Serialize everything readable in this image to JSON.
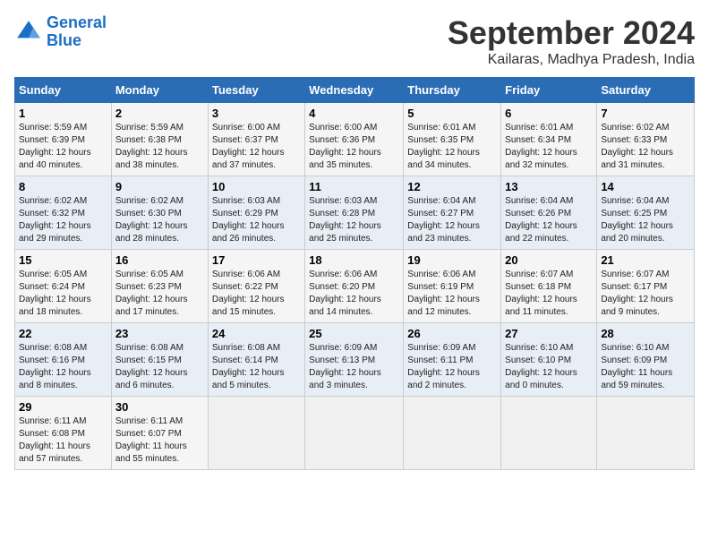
{
  "logo": {
    "line1": "General",
    "line2": "Blue"
  },
  "title": "September 2024",
  "location": "Kailaras, Madhya Pradesh, India",
  "days_of_week": [
    "Sunday",
    "Monday",
    "Tuesday",
    "Wednesday",
    "Thursday",
    "Friday",
    "Saturday"
  ],
  "weeks": [
    [
      {
        "day": "1",
        "info": "Sunrise: 5:59 AM\nSunset: 6:39 PM\nDaylight: 12 hours\nand 40 minutes."
      },
      {
        "day": "2",
        "info": "Sunrise: 5:59 AM\nSunset: 6:38 PM\nDaylight: 12 hours\nand 38 minutes."
      },
      {
        "day": "3",
        "info": "Sunrise: 6:00 AM\nSunset: 6:37 PM\nDaylight: 12 hours\nand 37 minutes."
      },
      {
        "day": "4",
        "info": "Sunrise: 6:00 AM\nSunset: 6:36 PM\nDaylight: 12 hours\nand 35 minutes."
      },
      {
        "day": "5",
        "info": "Sunrise: 6:01 AM\nSunset: 6:35 PM\nDaylight: 12 hours\nand 34 minutes."
      },
      {
        "day": "6",
        "info": "Sunrise: 6:01 AM\nSunset: 6:34 PM\nDaylight: 12 hours\nand 32 minutes."
      },
      {
        "day": "7",
        "info": "Sunrise: 6:02 AM\nSunset: 6:33 PM\nDaylight: 12 hours\nand 31 minutes."
      }
    ],
    [
      {
        "day": "8",
        "info": "Sunrise: 6:02 AM\nSunset: 6:32 PM\nDaylight: 12 hours\nand 29 minutes."
      },
      {
        "day": "9",
        "info": "Sunrise: 6:02 AM\nSunset: 6:30 PM\nDaylight: 12 hours\nand 28 minutes."
      },
      {
        "day": "10",
        "info": "Sunrise: 6:03 AM\nSunset: 6:29 PM\nDaylight: 12 hours\nand 26 minutes."
      },
      {
        "day": "11",
        "info": "Sunrise: 6:03 AM\nSunset: 6:28 PM\nDaylight: 12 hours\nand 25 minutes."
      },
      {
        "day": "12",
        "info": "Sunrise: 6:04 AM\nSunset: 6:27 PM\nDaylight: 12 hours\nand 23 minutes."
      },
      {
        "day": "13",
        "info": "Sunrise: 6:04 AM\nSunset: 6:26 PM\nDaylight: 12 hours\nand 22 minutes."
      },
      {
        "day": "14",
        "info": "Sunrise: 6:04 AM\nSunset: 6:25 PM\nDaylight: 12 hours\nand 20 minutes."
      }
    ],
    [
      {
        "day": "15",
        "info": "Sunrise: 6:05 AM\nSunset: 6:24 PM\nDaylight: 12 hours\nand 18 minutes."
      },
      {
        "day": "16",
        "info": "Sunrise: 6:05 AM\nSunset: 6:23 PM\nDaylight: 12 hours\nand 17 minutes."
      },
      {
        "day": "17",
        "info": "Sunrise: 6:06 AM\nSunset: 6:22 PM\nDaylight: 12 hours\nand 15 minutes."
      },
      {
        "day": "18",
        "info": "Sunrise: 6:06 AM\nSunset: 6:20 PM\nDaylight: 12 hours\nand 14 minutes."
      },
      {
        "day": "19",
        "info": "Sunrise: 6:06 AM\nSunset: 6:19 PM\nDaylight: 12 hours\nand 12 minutes."
      },
      {
        "day": "20",
        "info": "Sunrise: 6:07 AM\nSunset: 6:18 PM\nDaylight: 12 hours\nand 11 minutes."
      },
      {
        "day": "21",
        "info": "Sunrise: 6:07 AM\nSunset: 6:17 PM\nDaylight: 12 hours\nand 9 minutes."
      }
    ],
    [
      {
        "day": "22",
        "info": "Sunrise: 6:08 AM\nSunset: 6:16 PM\nDaylight: 12 hours\nand 8 minutes."
      },
      {
        "day": "23",
        "info": "Sunrise: 6:08 AM\nSunset: 6:15 PM\nDaylight: 12 hours\nand 6 minutes."
      },
      {
        "day": "24",
        "info": "Sunrise: 6:08 AM\nSunset: 6:14 PM\nDaylight: 12 hours\nand 5 minutes."
      },
      {
        "day": "25",
        "info": "Sunrise: 6:09 AM\nSunset: 6:13 PM\nDaylight: 12 hours\nand 3 minutes."
      },
      {
        "day": "26",
        "info": "Sunrise: 6:09 AM\nSunset: 6:11 PM\nDaylight: 12 hours\nand 2 minutes."
      },
      {
        "day": "27",
        "info": "Sunrise: 6:10 AM\nSunset: 6:10 PM\nDaylight: 12 hours\nand 0 minutes."
      },
      {
        "day": "28",
        "info": "Sunrise: 6:10 AM\nSunset: 6:09 PM\nDaylight: 11 hours\nand 59 minutes."
      }
    ],
    [
      {
        "day": "29",
        "info": "Sunrise: 6:11 AM\nSunset: 6:08 PM\nDaylight: 11 hours\nand 57 minutes."
      },
      {
        "day": "30",
        "info": "Sunrise: 6:11 AM\nSunset: 6:07 PM\nDaylight: 11 hours\nand 55 minutes."
      },
      {
        "day": "",
        "info": ""
      },
      {
        "day": "",
        "info": ""
      },
      {
        "day": "",
        "info": ""
      },
      {
        "day": "",
        "info": ""
      },
      {
        "day": "",
        "info": ""
      }
    ]
  ]
}
